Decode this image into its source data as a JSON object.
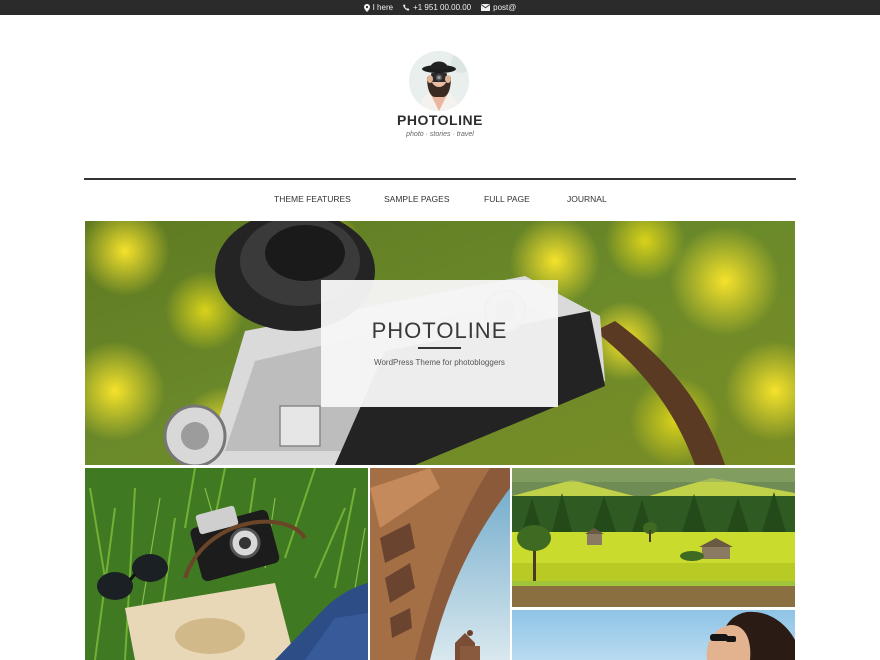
{
  "topbar": {
    "location": "I here",
    "phone": "+1 951 00.00.00",
    "email": "post@"
  },
  "site": {
    "title": "PHOTOLINE",
    "tagline": "photo · stories · travel"
  },
  "nav": {
    "items": [
      "THEME FEATURES",
      "SAMPLE PAGES",
      "FULL PAGE",
      "JOURNAL"
    ]
  },
  "hero": {
    "title": "PHOTOLINE",
    "subtitle": "WordPress Theme for photobloggers"
  },
  "icons": {
    "location": "map-marker-icon",
    "phone": "phone-icon",
    "email": "envelope-icon"
  },
  "colors": {
    "topbar_bg": "#2b2b2b",
    "text_dark": "#333333",
    "hero_box": "#f6f6f6"
  }
}
